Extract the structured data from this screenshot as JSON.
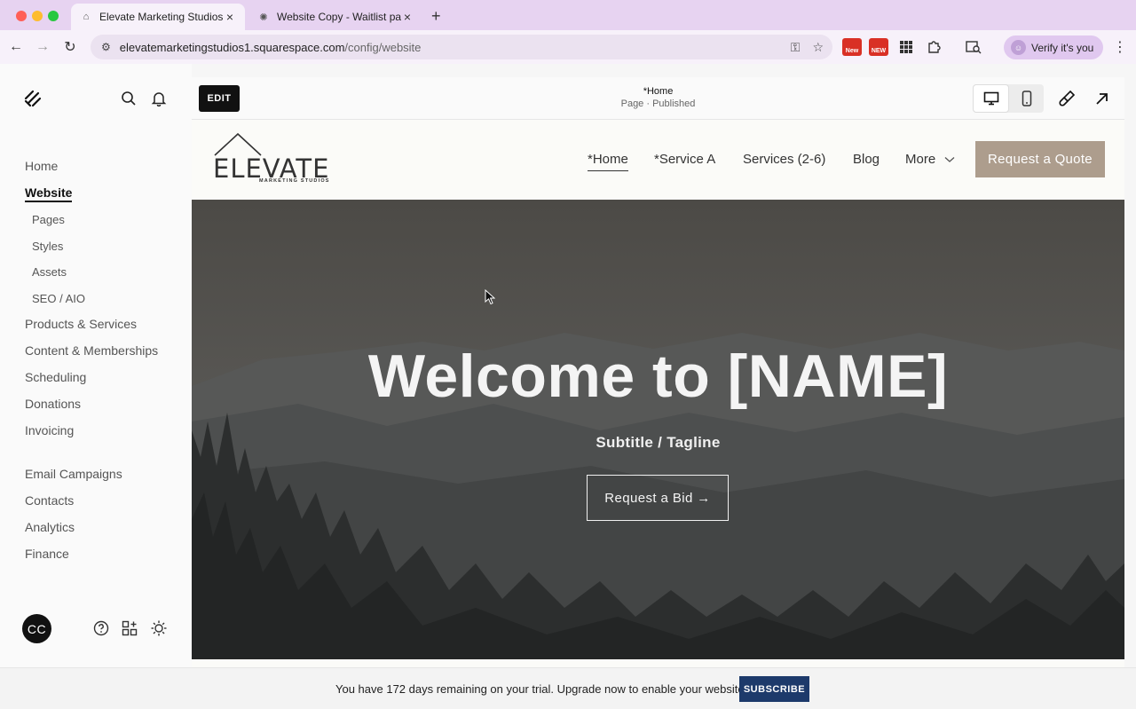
{
  "browser": {
    "tabs": [
      {
        "title": "Elevate Marketing Studios |",
        "favicon": "elevate-favicon",
        "active": true
      },
      {
        "title": "Website Copy - Waitlist page",
        "favicon": "openai-favicon",
        "active": false
      }
    ],
    "url_host": "elevatemarketingstudios1.squarespace.com",
    "url_path": "/config/website",
    "profile_label": "Verify it's you",
    "ext_badge_1": "New",
    "ext_badge_2": "NEW"
  },
  "sidebar": {
    "nav": [
      {
        "label": "Home"
      },
      {
        "label": "Website",
        "active": true
      },
      {
        "label": "Products & Services"
      },
      {
        "label": "Content & Memberships"
      },
      {
        "label": "Scheduling"
      },
      {
        "label": "Donations"
      },
      {
        "label": "Invoicing"
      },
      {
        "label": "Email Campaigns"
      },
      {
        "label": "Contacts"
      },
      {
        "label": "Analytics"
      },
      {
        "label": "Finance"
      }
    ],
    "sub": [
      {
        "label": "Pages"
      },
      {
        "label": "Styles"
      },
      {
        "label": "Assets"
      },
      {
        "label": "SEO / AIO"
      }
    ],
    "avatar_initials": "CC"
  },
  "editor": {
    "edit_label": "EDIT",
    "page_title": "*Home",
    "page_status": "Page · Published"
  },
  "site": {
    "brand_word": "ELEVATE",
    "brand_sub": "MARKETING STUDIOS",
    "nav": [
      {
        "label": "*Home",
        "current": true
      },
      {
        "label": "*Service A"
      },
      {
        "label": "Services (2-6)"
      },
      {
        "label": "Blog"
      },
      {
        "label": "More"
      }
    ],
    "quote_button": "Request a Quote",
    "hero_title": "Welcome to [NAME]",
    "hero_subtitle": "Subtitle / Tagline",
    "hero_button": "Request a Bid →"
  },
  "trial": {
    "message": "You have 172 days remaining on your trial. Upgrade now to enable your website.",
    "button": "SUBSCRIBE"
  },
  "colors": {
    "accent_quote": "#ad9d8d",
    "subscribe": "#1d3a6b",
    "browser_chrome": "#e7d3f1"
  }
}
